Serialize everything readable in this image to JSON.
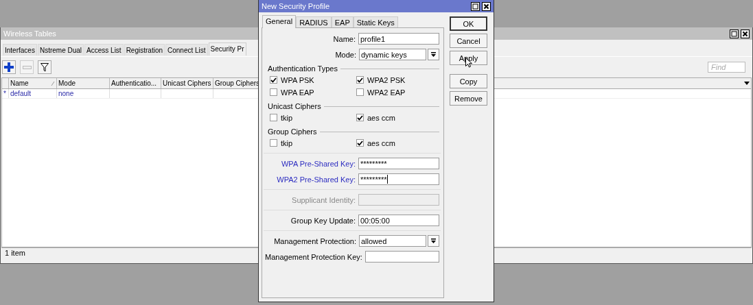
{
  "back_window": {
    "title": "Wireless Tables",
    "tabs": [
      {
        "label": "Interfaces",
        "selected": false
      },
      {
        "label": "Nstreme Dual",
        "selected": false
      },
      {
        "label": "Access List",
        "selected": false
      },
      {
        "label": "Registration",
        "selected": false
      },
      {
        "label": "Connect List",
        "selected": false
      },
      {
        "label": "Security Pr",
        "selected": true
      }
    ],
    "find": {
      "placeholder": "Find"
    },
    "table": {
      "columns": [
        "Name",
        "Mode",
        "Authenticatio...",
        "Unicast Ciphers",
        "Group Ciphers"
      ],
      "rows": [
        {
          "marker": "*",
          "cells": [
            "default",
            "none"
          ]
        }
      ]
    },
    "status_bar": "1 item"
  },
  "dialog": {
    "title": "New Security Profile",
    "tabs": [
      {
        "label": "General",
        "selected": true
      },
      {
        "label": "RADIUS",
        "selected": false
      },
      {
        "label": "EAP",
        "selected": false
      },
      {
        "label": "Static Keys",
        "selected": false
      }
    ],
    "sections": [
      {
        "kind": "fields",
        "fields": [
          {
            "kind": "text",
            "label": "Name:",
            "value": "profile1",
            "highlight": false,
            "disabled": false
          },
          {
            "kind": "select",
            "label": "Mode:",
            "value": "dynamic keys",
            "highlight": false,
            "disabled": false
          }
        ]
      },
      {
        "kind": "checks",
        "title": "Authentication Types",
        "items": [
          {
            "label": "WPA PSK",
            "checked": true
          },
          {
            "label": "WPA2 PSK",
            "checked": true
          },
          {
            "label": "WPA EAP",
            "checked": false
          },
          {
            "label": "WPA2 EAP",
            "checked": false
          }
        ]
      },
      {
        "kind": "checks",
        "title": "Unicast Ciphers",
        "items": [
          {
            "label": "tkip",
            "checked": false
          },
          {
            "label": "aes ccm",
            "checked": true
          }
        ]
      },
      {
        "kind": "checks",
        "title": "Group Ciphers",
        "items": [
          {
            "label": "tkip",
            "checked": false
          },
          {
            "label": "aes ccm",
            "checked": true
          }
        ]
      },
      {
        "kind": "fields",
        "fields": [
          {
            "kind": "text",
            "label": "WPA Pre-Shared Key:",
            "value": "*********",
            "highlight": true,
            "disabled": false
          },
          {
            "kind": "text",
            "label": "WPA2 Pre-Shared Key:",
            "value": "*********",
            "highlight": true,
            "disabled": false,
            "focused": true
          }
        ]
      },
      {
        "kind": "fields",
        "fields": [
          {
            "kind": "text",
            "label": "Supplicant Identity:",
            "disabled": true
          }
        ]
      },
      {
        "kind": "fields",
        "fields": [
          {
            "kind": "text",
            "label": "Group Key Update:",
            "value": "00:05:00",
            "highlight": false,
            "disabled": false
          }
        ]
      },
      {
        "kind": "fields",
        "fields": [
          {
            "kind": "select",
            "label": "Management Protection:",
            "value": "allowed",
            "highlight": false,
            "disabled": false
          },
          {
            "kind": "text",
            "label": "Management Protection Key:",
            "highlight": false,
            "disabled": false
          }
        ]
      }
    ],
    "buttons": [
      {
        "label": "OK",
        "default": true
      },
      {
        "label": "Cancel",
        "default": false
      },
      {
        "label": "Apply",
        "default": false
      },
      {
        "label": "Copy",
        "default": false
      },
      {
        "label": "Remove",
        "default": false
      }
    ]
  }
}
